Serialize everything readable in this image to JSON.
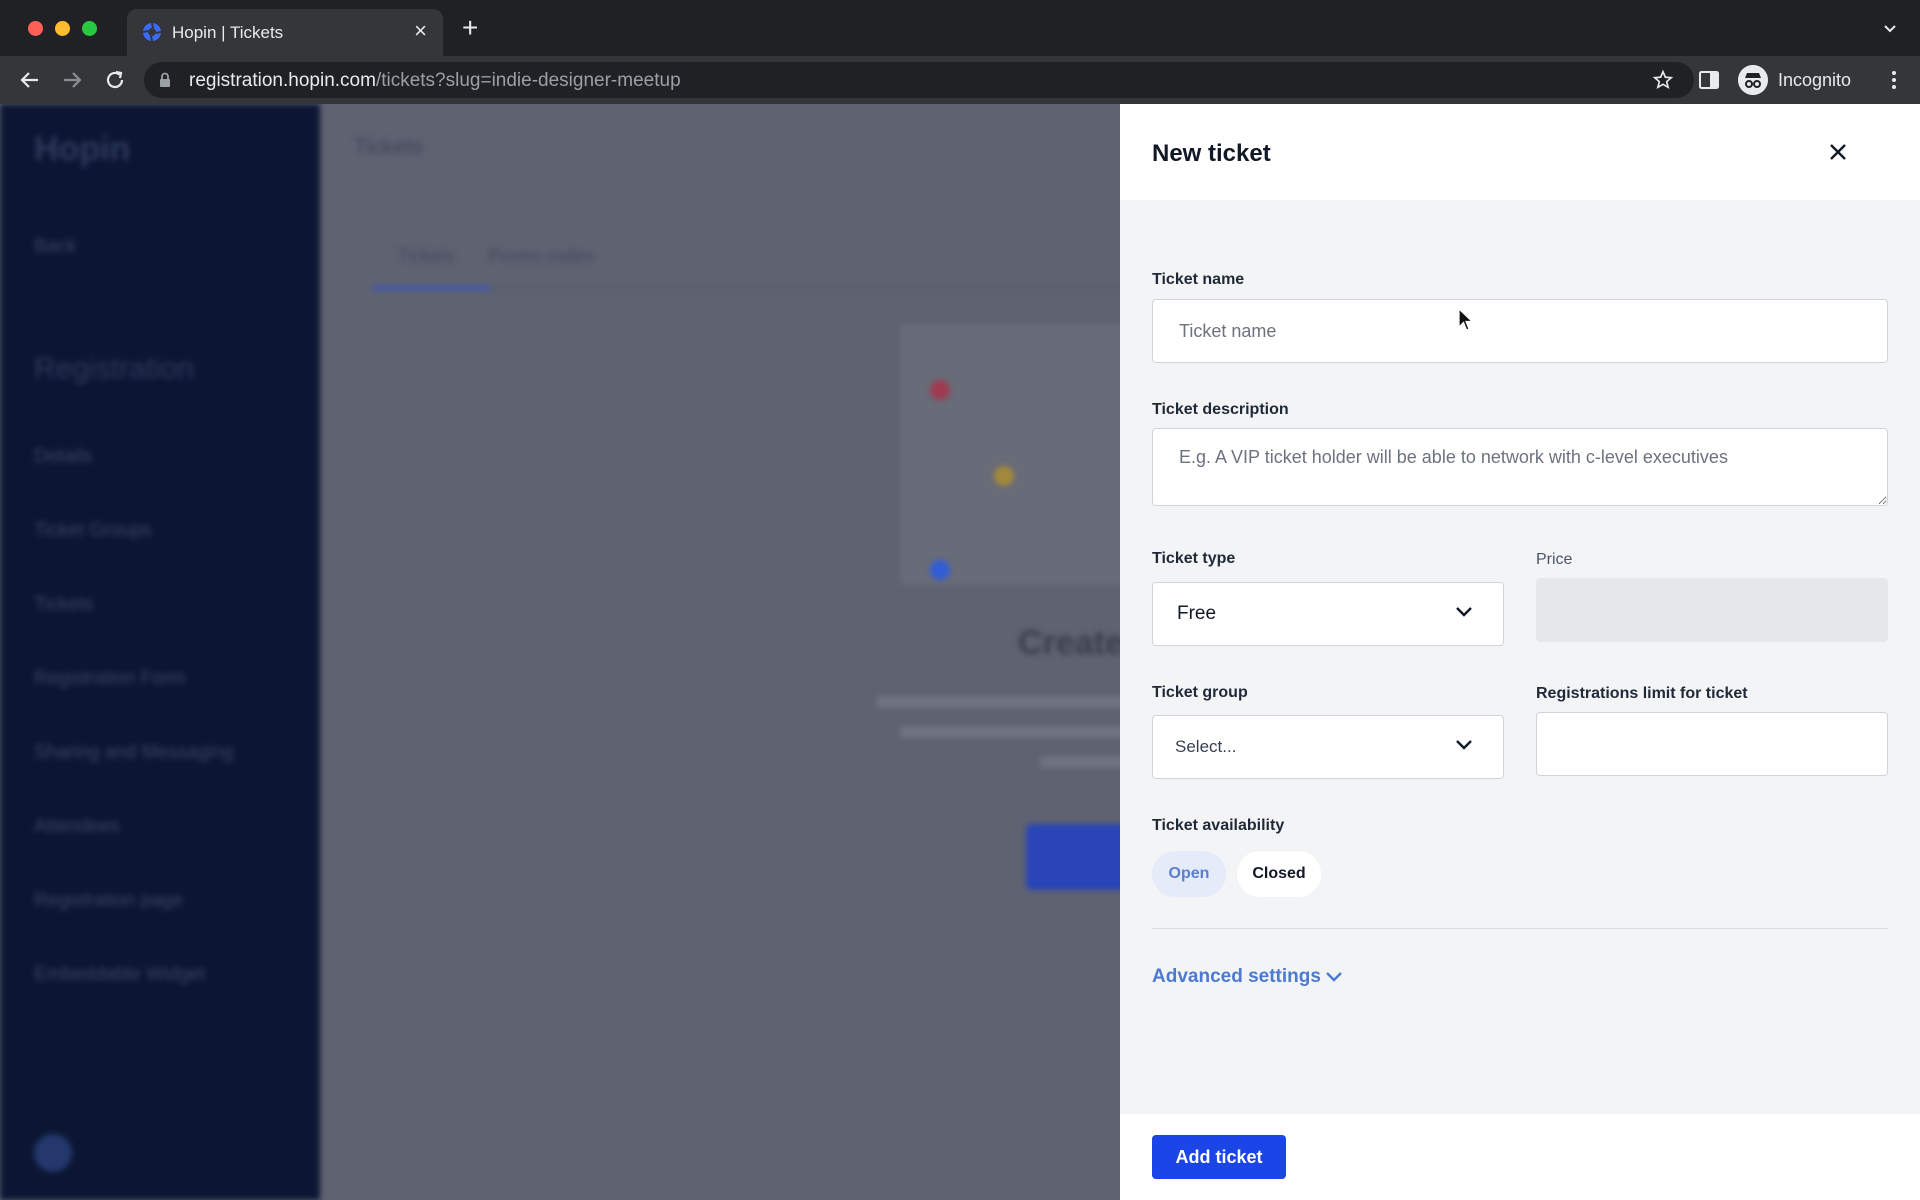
{
  "browser": {
    "tab_title": "Hopin | Tickets",
    "url_host": "registration.hopin.com",
    "url_path": "/tickets?slug=indie-designer-meetup",
    "profile_label": "Incognito"
  },
  "background": {
    "brand": "Hopin",
    "page_title": "Tickets",
    "back_label": "Back",
    "section_title": "Registration",
    "sidebar_items": [
      "Details",
      "Ticket Groups",
      "Tickets",
      "Registration Form",
      "Sharing and Messaging",
      "Attendees",
      "Registration page",
      "Embeddable Widget"
    ],
    "tabs": [
      "Tickets",
      "Promo codes"
    ],
    "empty_heading": "Create"
  },
  "drawer": {
    "title": "New ticket",
    "ticket_name": {
      "label": "Ticket name",
      "placeholder": "Ticket name"
    },
    "ticket_description": {
      "label": "Ticket description",
      "placeholder": "E.g. A VIP ticket holder will be able to network with c-level executives"
    },
    "ticket_type": {
      "label": "Ticket type",
      "value": "Free"
    },
    "price": {
      "label": "Price"
    },
    "ticket_group": {
      "label": "Ticket group",
      "placeholder": "Select..."
    },
    "registrations_limit": {
      "label": "Registrations limit for ticket"
    },
    "availability": {
      "label": "Ticket availability",
      "options": [
        "Open",
        "Closed"
      ],
      "selected": "Open"
    },
    "advanced_settings": "Advanced settings",
    "add_button": "Add ticket"
  },
  "colors": {
    "primary": "#1b45e6",
    "link": "#4d79d1",
    "overlay": "#5f6271",
    "sidebar": "#0b1633"
  }
}
